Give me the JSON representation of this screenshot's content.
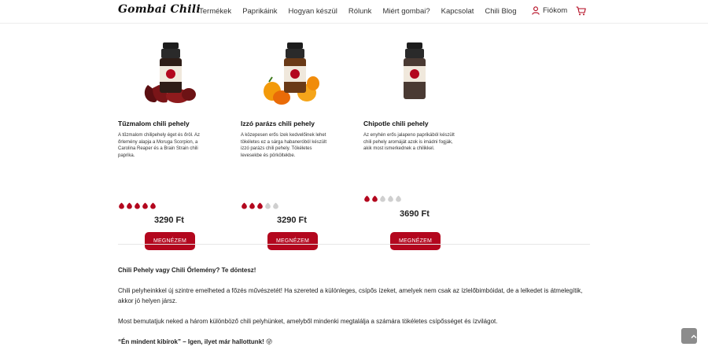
{
  "header": {
    "logo": "Gombai Chili",
    "nav": [
      "Termékek",
      "Paprikáink",
      "Hogyan készül",
      "Rólunk",
      "Miért gombai?",
      "Kapcsolat",
      "Chili Blog"
    ],
    "account_label": "Fiókom"
  },
  "products": [
    {
      "name": "Tűzmalom chili pehely",
      "description": "A tűzmalom chilipehely éget és őröl. Az őrlemény alapja a Moruga Scorpion, a Carolina Reaper és a Brain Strain chili paprika.",
      "rating": 5,
      "rating_max": 5,
      "price": "3290 Ft",
      "button": "MEGNÉZEM"
    },
    {
      "name": "Izzó parázs chili pehely",
      "description": "A közepesen erős ízek kedvelőinek lehet tökéletes ez a sárga habaneróból készült izzó parázs chili pehely. Tökéletes levesekbe és pörköltekbe.",
      "rating": 3,
      "rating_max": 5,
      "price": "3290 Ft",
      "button": "MEGNÉZEM"
    },
    {
      "name": "Chipotle chili pehely",
      "description": "Az enyhén erős jalapeno paprikából készült chili pehely aromáját azok is imádni fogják, akik most ismerkednek a chilikkel.",
      "rating": 2,
      "rating_max": 5,
      "price": "3690 Ft",
      "button": "MEGNÉZEM"
    }
  ],
  "article": {
    "heading": "Chili Pehely vagy Chili Őrlemény? Te döntesz!",
    "p1": "Chili pelyheinkkel új szintre emelheted a főzés művészetét! Ha szereted a különleges, csípős ízeket, amelyek nem csak az ízlelőbimbóidat, de a lelkedet is átmelegítik, akkor jó helyen jársz.",
    "p2": "Most bemutatjuk neked a három különböző chili pelyhünket, amelyből mindenki megtalálja a számára tökéletes csípősséget és ízvilágot.",
    "p3": "“Én mindent kibírok” – Igen, ilyet már hallottunk! 😜"
  },
  "colors": {
    "accent": "#b3071e",
    "pepper_filled": "#b3071e",
    "pepper_empty": "#cfcfcf"
  }
}
